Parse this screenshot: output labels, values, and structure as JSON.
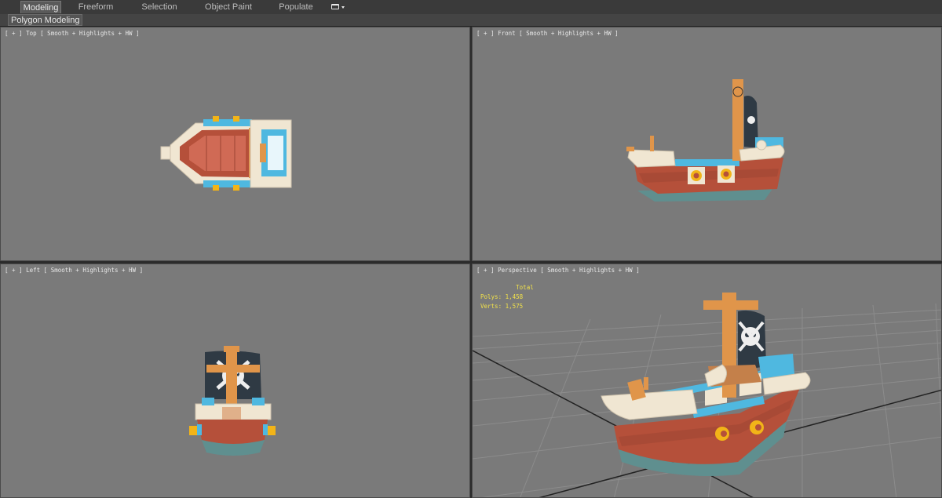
{
  "ribbon": {
    "tabs": [
      {
        "label": "Modeling",
        "active": true
      },
      {
        "label": "Freeform",
        "active": false
      },
      {
        "label": "Selection",
        "active": false
      },
      {
        "label": "Object Paint",
        "active": false
      },
      {
        "label": "Populate",
        "active": false
      }
    ],
    "dropdown_icon": "window-dropdown-icon"
  },
  "subbar": {
    "label": "Polygon Modeling"
  },
  "viewports": {
    "top": {
      "label": "[ + ] Top [ Smooth + Highlights + HW ]"
    },
    "front": {
      "label": "[ + ] Front [ Smooth + Highlights + HW ]"
    },
    "left": {
      "label": "[ + ] Left [ Smooth + Highlights + HW ]"
    },
    "perspective": {
      "label": "[ + ] Perspective [ Smooth + Highlights + HW ]",
      "stats": {
        "header": "Total",
        "polys_label": "Polys:",
        "polys_value": "1,458",
        "verts_label": "Verts:",
        "verts_value": "1,575"
      }
    }
  },
  "colors": {
    "viewport_bg": "#7a7a7a",
    "hull_red": "#b5503a",
    "hull_base": "#5f8f8f",
    "trim_blue": "#4fb8e0",
    "wood_orange": "#e0954a",
    "cream": "#f0e6d2",
    "sail_dark": "#2f3a44",
    "cannon_yellow": "#f2b418",
    "stats_yellow": "#f2e24a"
  }
}
